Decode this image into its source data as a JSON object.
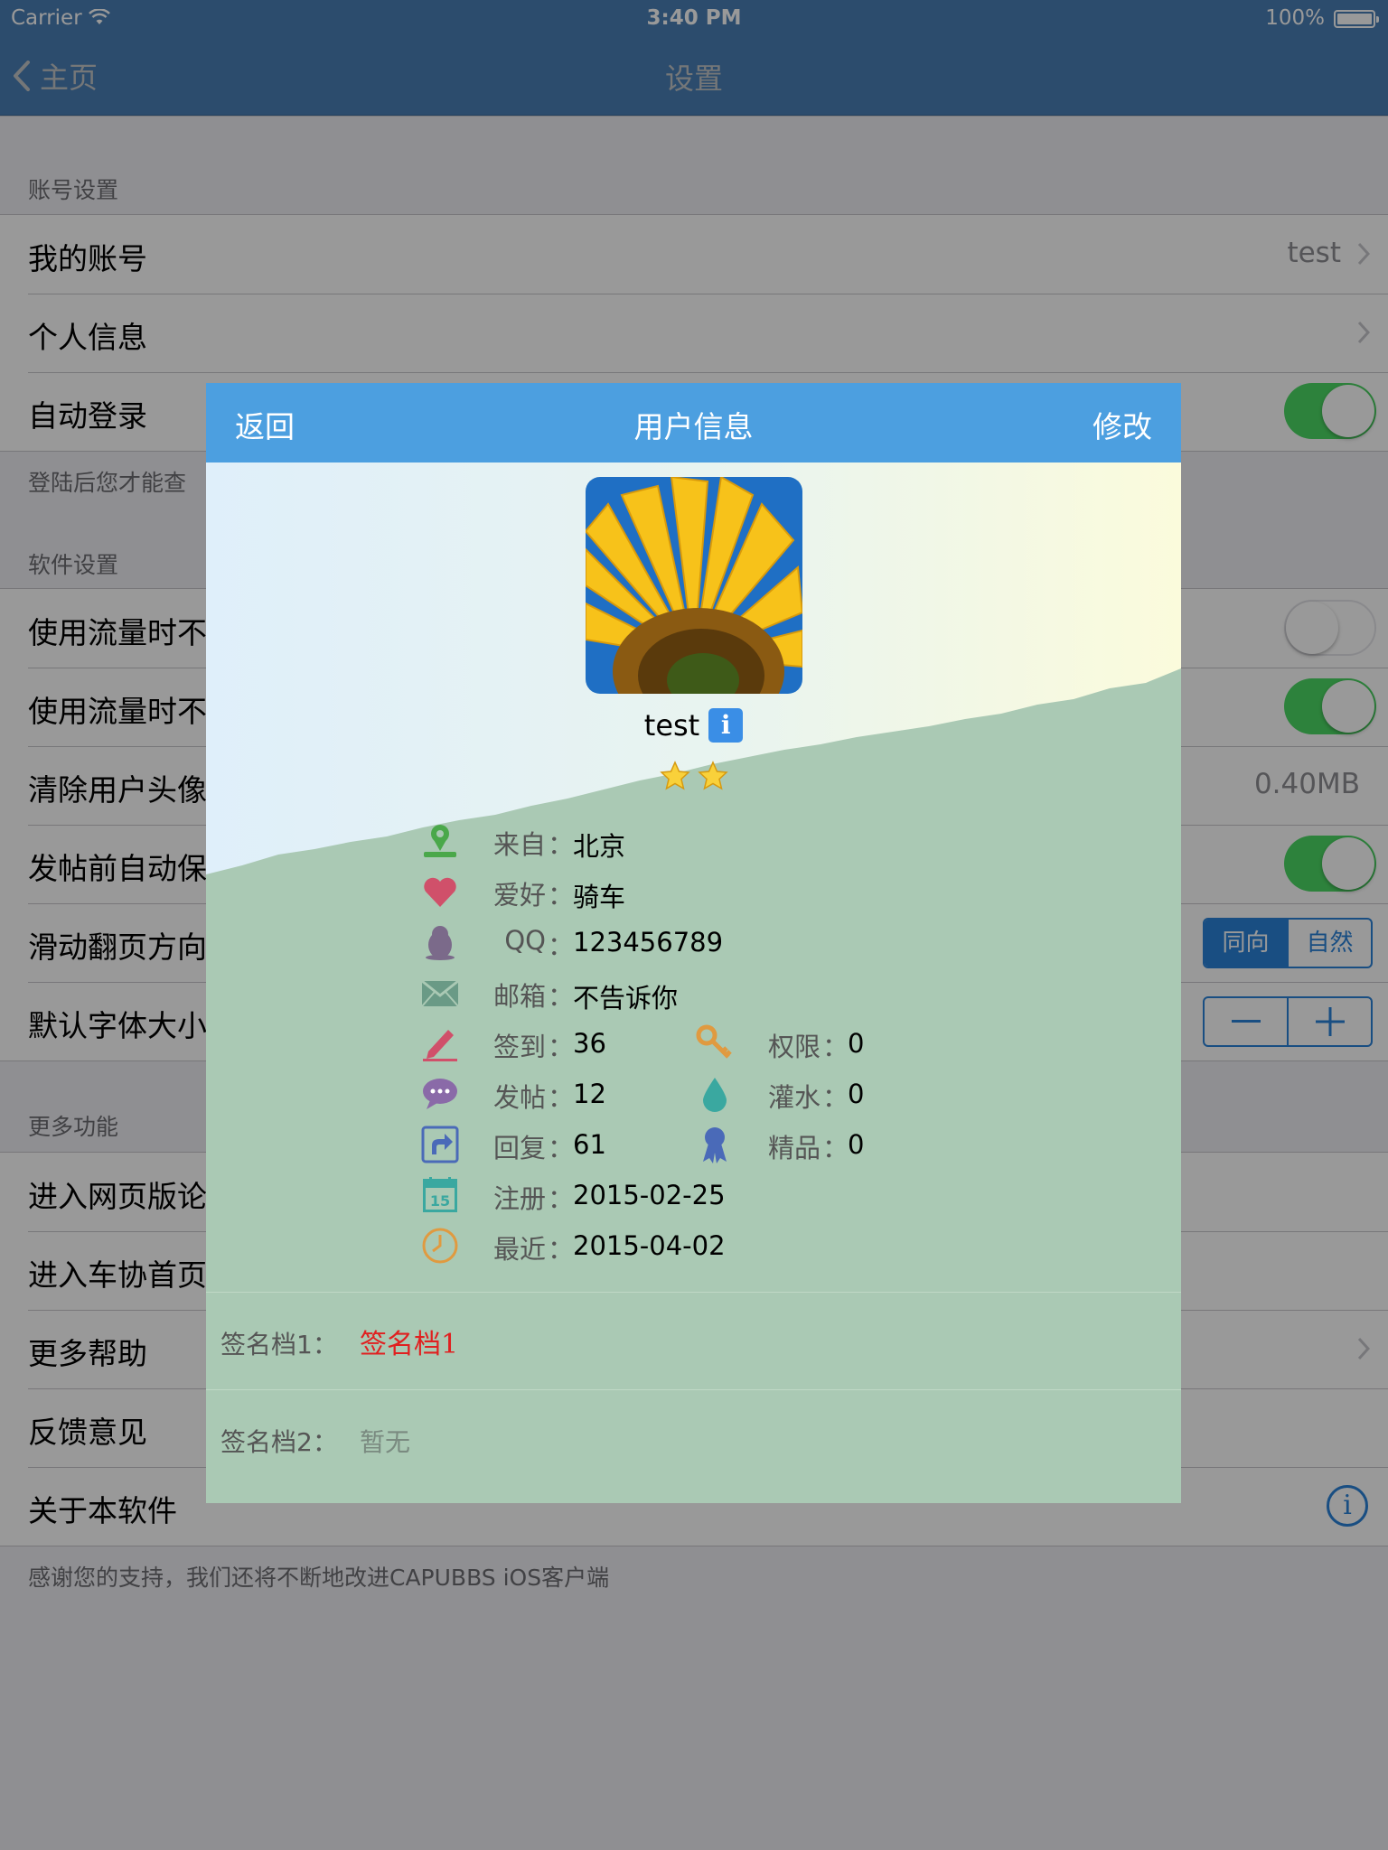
{
  "status_bar": {
    "carrier": "Carrier",
    "time": "3:40 PM",
    "battery": "100%"
  },
  "nav": {
    "back_label": "主页",
    "title": "设置"
  },
  "settings": {
    "account_header": "账号设置",
    "my_account": "我的账号",
    "my_account_value": "test",
    "personal_info": "个人信息",
    "auto_login": "自动登录",
    "auto_login_footer": "登陆后您才能查",
    "software_header": "软件设置",
    "traffic_1": "使用流量时不",
    "traffic_2": "使用流量时不",
    "clear_cache": "清除用户头像",
    "clear_cache_value": "0.40MB",
    "autosave": "发帖前自动保",
    "swipe_direction": "滑动翻页方向",
    "segment_a": "同向",
    "segment_b": "自然",
    "font_size": "默认字体大小",
    "more_header": "更多功能",
    "web_forum": "进入网页版论",
    "club_home": "进入车协首页",
    "more_help": "更多帮助",
    "feedback": "反馈意见",
    "about": "关于本软件",
    "footer": "感谢您的支持，我们还将不断地改进CAPUBBS iOS客户端"
  },
  "toggles": {
    "auto_login": true,
    "traffic_1": false,
    "traffic_2": true,
    "autosave": true
  },
  "colors": {
    "nav_bar": "#4a7fb6",
    "modal_bar": "#4c9fe0",
    "modal_body": "#aac9b4",
    "switch_on": "#4cd964",
    "accent": "#2b82d9",
    "signature_red": "#e02020"
  },
  "modal": {
    "back": "返回",
    "title": "用户信息",
    "edit": "修改",
    "username": "test",
    "info_badge": "i",
    "star_count": 2,
    "colon": "：",
    "from_label": "来自",
    "from_value": "北京",
    "hobby_label": "爱好",
    "hobby_value": "骑车",
    "qq_label": "QQ",
    "qq_value": "123456789",
    "email_label": "邮箱",
    "email_value": "不告诉你",
    "signin_label": "签到",
    "signin_value": "36",
    "permission_label": "权限",
    "permission_value": "0",
    "posts_label": "发帖",
    "posts_value": "12",
    "water_label": "灌水",
    "water_value": "0",
    "replies_label": "回复",
    "replies_value": "61",
    "featured_label": "精品",
    "featured_value": "0",
    "register_label": "注册",
    "register_value": "2015-02-25",
    "recent_label": "最近",
    "recent_value": "2015-04-02",
    "sig1_label": "签名档1：",
    "sig1_value": "签名档1",
    "sig2_label": "签名档2：",
    "sig2_value": "暂无"
  },
  "icons": {
    "location": "location-pin-icon",
    "hobby": "heart-icon",
    "qq": "qq-penguin-icon",
    "email": "envelope-icon",
    "signin": "pencil-icon",
    "permission": "key-icon",
    "posts": "speech-bubble-icon",
    "water": "water-drop-icon",
    "replies": "reply-arrow-icon",
    "featured": "ribbon-icon",
    "register": "calendar-icon",
    "recent": "clock-icon"
  }
}
